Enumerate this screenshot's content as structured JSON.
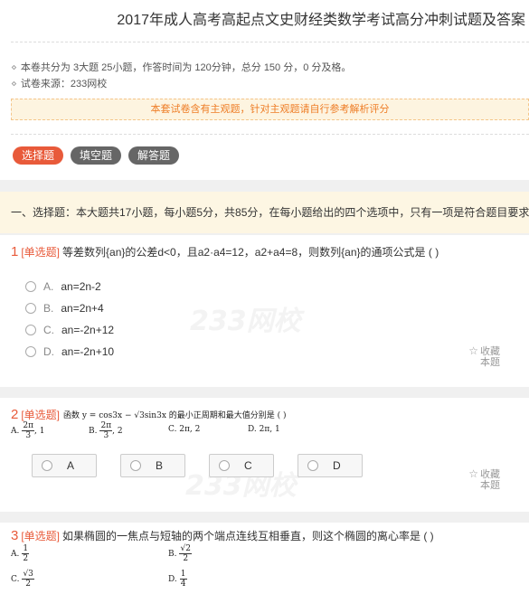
{
  "header": {
    "title": "2017年成人高考高起点文史财经类数学考试高分冲刺试题及答案",
    "meta_line1": "本卷共分为 3大题 25小题，作答时间为 120分钟，总分 150 分，0 分及格。",
    "meta_line2": "试卷来源：233网校",
    "notice": "本套试卷含有主观题，针对主观题请自行参考解析评分"
  },
  "tabs": [
    "选择题",
    "填空题",
    "解答题"
  ],
  "section_desc": "一、选择题：本大题共17小题，每小题5分，共85分，在每小题给出的四个选项中，只有一项是符合题目要求的．",
  "collect": {
    "line1": "收藏",
    "line2": "本题"
  },
  "watermark": "233网校",
  "q1": {
    "num": "1",
    "type": "[单选题]",
    "text": "等差数列{an}的公差d<0，且a2·a4=12，a2+a4=8，则数列{an}的通项公式是 (        )",
    "options": [
      {
        "letter": "A.",
        "text": "an=2n-2"
      },
      {
        "letter": "B.",
        "text": "an=2n+4"
      },
      {
        "letter": "C.",
        "text": "an=-2n+12"
      },
      {
        "letter": "D.",
        "text": "an=-2n+10"
      }
    ]
  },
  "q2": {
    "num": "2",
    "type": "[单选题]",
    "formula": "函数 y = cos3x − √3sin3x 的最小正周期和最大值分别是 (        )",
    "opt_a_label": "A.",
    "opt_a_num": "2π",
    "opt_a_den": "3",
    "opt_a_tail": ", 1",
    "opt_b_label": "B.",
    "opt_b_num": "2π",
    "opt_b_den": "3",
    "opt_b_tail": ", 2",
    "opt_c": "C. 2π, 2",
    "opt_d": "D. 2π, 1",
    "answers": [
      "A",
      "B",
      "C",
      "D"
    ]
  },
  "q3": {
    "num": "3",
    "type": "[单选题]",
    "text": "如果椭圆的一焦点与短轴的两个端点连线互相垂直，则这个椭圆的离心率是 (        )",
    "opt_a_label": "A.",
    "opt_a_num": "1",
    "opt_a_den": "2",
    "opt_b_label": "B.",
    "opt_b_num": "√2",
    "opt_b_den": "2",
    "opt_c_label": "C.",
    "opt_c_num": "√3",
    "opt_c_den": "2",
    "opt_d_label": "D.",
    "opt_d_num": "1",
    "opt_d_den": "4"
  }
}
